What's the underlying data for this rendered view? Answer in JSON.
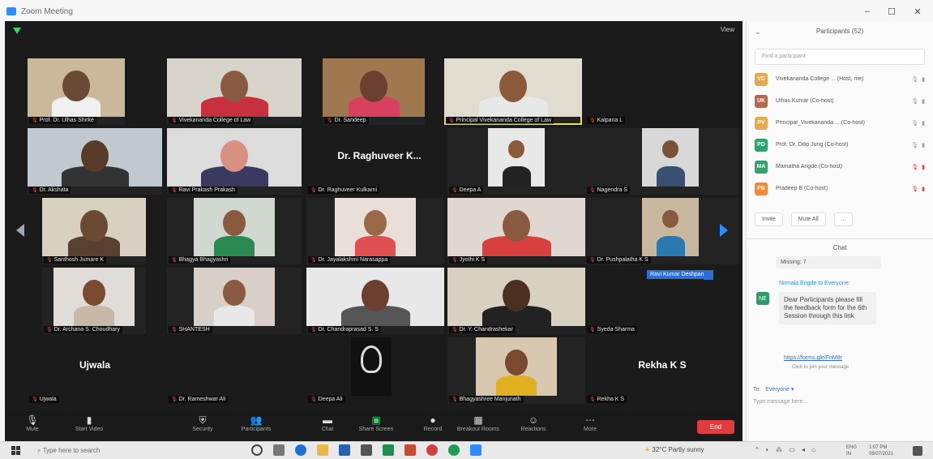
{
  "window": {
    "title": "Zoom Meeting",
    "controls": [
      "–",
      "☐",
      "✕"
    ]
  },
  "video": {
    "view_label": "View",
    "tiles": [
      {
        "name": "Prof. Dr. Ulhas Shirke"
      },
      {
        "name": "Vivekananda College of Law"
      },
      {
        "name": "Dr. Sandeep"
      },
      {
        "name": "Principal Vivekananda College of Law"
      },
      {
        "name": "Kalpana L"
      },
      {
        "name": "Dr. Akshata"
      },
      {
        "name": "Ravi Prakash Prakash"
      },
      {
        "name": "Dr. Raghuveer K..."
      },
      {
        "name": "Dr. Raghuveer Kulkarni"
      },
      {
        "name": "Deepa A"
      },
      {
        "name": "Nagendra S"
      },
      {
        "name": "Santhosh Jumare K"
      },
      {
        "name": "Bhagya Bhagyashri"
      },
      {
        "name": "Dr. Jayalakshmi Narasappa"
      },
      {
        "name": "Jyothi K S"
      },
      {
        "name": "Dr. Pushpalatha K S"
      },
      {
        "name": "Dr. Archana S. Choudhary"
      },
      {
        "name": "SHANTESH"
      },
      {
        "name": "Dr. Chandraprasad S. S"
      },
      {
        "name": "Dr. Y. Chandrashekar"
      },
      {
        "name": "Syeda Sharma"
      },
      {
        "name": "Ujwala"
      },
      {
        "name": "Ujwala"
      },
      {
        "name": "Dr. Rameshwar Ali"
      },
      {
        "name": "Deepa Ali"
      },
      {
        "name": "Bhagyashree Manjunath"
      },
      {
        "name": "Rekha K S"
      },
      {
        "name": "Rekha K S"
      }
    ],
    "hand_badge": "Ravi Kumar Deshpande"
  },
  "toolbar": {
    "buttons": [
      {
        "label": "Mute",
        "icon": "mic-icon"
      },
      {
        "label": "Start Video",
        "icon": "video-icon"
      },
      {
        "label": "Security",
        "icon": "shield-icon"
      },
      {
        "label": "Participants",
        "icon": "participants-icon"
      },
      {
        "label": "Chat",
        "icon": "chat-icon"
      },
      {
        "label": "Share Screen",
        "icon": "share-icon"
      },
      {
        "label": "Record",
        "icon": "record-icon"
      },
      {
        "label": "Breakout Rooms",
        "icon": "breakout-icon"
      },
      {
        "label": "Reactions",
        "icon": "reactions-icon"
      },
      {
        "label": "More",
        "icon": "more-icon"
      }
    ],
    "end_label": "End"
  },
  "panel": {
    "title": "Participants (52)",
    "search_placeholder": "Find a participant",
    "participants": [
      {
        "initials": "VC",
        "name": "Vivekananda College ... (Host, me)",
        "color": "#e8a94a",
        "muted": false
      },
      {
        "initials": "UK",
        "name": "Ulhas Kumar (Co-host)",
        "color": "#b06a4a",
        "muted": false
      },
      {
        "initials": "PV",
        "name": "Principal_Vivekananda ... (Co-host)",
        "color": "#e8a94a",
        "muted": false
      },
      {
        "initials": "PD",
        "name": "Prof. Dr. Dilip Jung (Co-host)",
        "color": "#2ea36e",
        "muted": false
      },
      {
        "initials": "MA",
        "name": "Mamatha Angde (Co-host)",
        "color": "#2ea36e",
        "muted": true
      },
      {
        "initials": "PB",
        "name": "Pradeep B (Co-host)",
        "color": "#f08a3a",
        "muted": true
      }
    ],
    "invite_label": "Invite",
    "mute_all_label": "Mute All",
    "more_label": "...",
    "chat_title": "Chat",
    "chat_prev": "Missing: 7",
    "chat_sender": "Nirmala Engde to Everyone:",
    "chat_avatar": "NE",
    "chat_message": "Dear Participants please fill the feedback form for the 6th Session through this link",
    "chat_link": "https://forms.gle/FnM8r",
    "chat_sub": "Click to join your message",
    "to_label": "To:",
    "to_recipient": "Everyone ▾",
    "input_placeholder": "Type message here..."
  },
  "taskbar": {
    "search": "Type here to search",
    "weather": "32°C  Partly sunny",
    "tray": "^ ◗ ⁂ ▭ ◂ ⌂",
    "lang": "ENG\nIN",
    "time": "1:07 PM\n08/07/2021"
  }
}
